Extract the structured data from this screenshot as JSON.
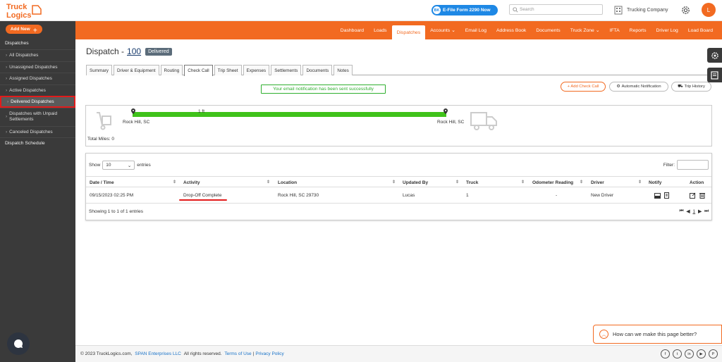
{
  "brand": {
    "logo_line1": "Truck",
    "logo_line2": "Logics"
  },
  "header": {
    "efile_bk": "BK",
    "efile_label": "E-File Form 2290 Now",
    "search_placeholder": "Search",
    "company": "Trucking Company",
    "user_initial": "L"
  },
  "sidebar": {
    "add_new": "Add New",
    "section": "Dispatches",
    "items": [
      {
        "label": "All Dispatches"
      },
      {
        "label": "Unassigned Dispatches"
      },
      {
        "label": "Assigned Dispatches"
      },
      {
        "label": "Active Dispatches"
      },
      {
        "label": "Delivered Dispatches"
      },
      {
        "label": "Dispatches with Unpaid Settlements"
      },
      {
        "label": "Canceled Dispatches"
      }
    ],
    "schedule": "Dispatch Schedule"
  },
  "nav": [
    "Dashboard",
    "Loads",
    "Dispatches",
    "Accounts ⌄",
    "Email Log",
    "Address Book",
    "Documents",
    "Truck Zone ⌄",
    "IFTA",
    "Reports",
    "Driver Log",
    "Load Board"
  ],
  "page": {
    "title_prefix": "Dispatch -",
    "dispatch_no": "100",
    "status": "Delivered",
    "tabs": [
      "Summary",
      "Driver & Equipment",
      "Routing",
      "Check Call",
      "Trip Sheet",
      "Expenses",
      "Settlements",
      "Documents",
      "Notes"
    ],
    "success_msg": "Your email notification has been sent successfully",
    "btn_add": "+ Add Check Call",
    "btn_auto": "Automatic Notification",
    "btn_trip": "Trip History"
  },
  "route": {
    "distance": "1 ft",
    "origin": "Rock Hill, SC",
    "destination": "Rock Hill, SC",
    "total_miles_label": "Total Miles:",
    "total_miles": "0"
  },
  "table": {
    "show_label": "Show",
    "show_value": "10",
    "entries_label": "entries",
    "filter_label": "Filter:",
    "columns": [
      "Date / Time",
      "Activity",
      "Location",
      "Updated By",
      "Truck",
      "Odometer Reading",
      "Driver",
      "Notify",
      "Action"
    ],
    "rows": [
      {
        "date": "09/15/2023 02:25 PM",
        "activity": "Drop-Off Complete",
        "location": "Rock Hill, SC 29730",
        "updated_by": "Lucas",
        "truck": "1",
        "odometer": "-",
        "driver": "New Driver"
      }
    ],
    "info": "Showing 1 to 1 of 1 entries",
    "page": "1"
  },
  "feedback": "How can we make this page better?",
  "footer": {
    "copy": "© 2023 TruckLogics.com,",
    "span": "SPAN Enterprises LLC",
    "rights": "All rights reserved.",
    "terms": "Terms of Use",
    "sep": "|",
    "privacy": "Privacy Policy"
  },
  "social": [
    "f",
    "t",
    "in",
    "▶",
    "P"
  ],
  "colors": {
    "accent": "#f26a21",
    "success": "#2eaf2e",
    "progress": "#3fc21a",
    "highlight": "#e21b1b"
  }
}
